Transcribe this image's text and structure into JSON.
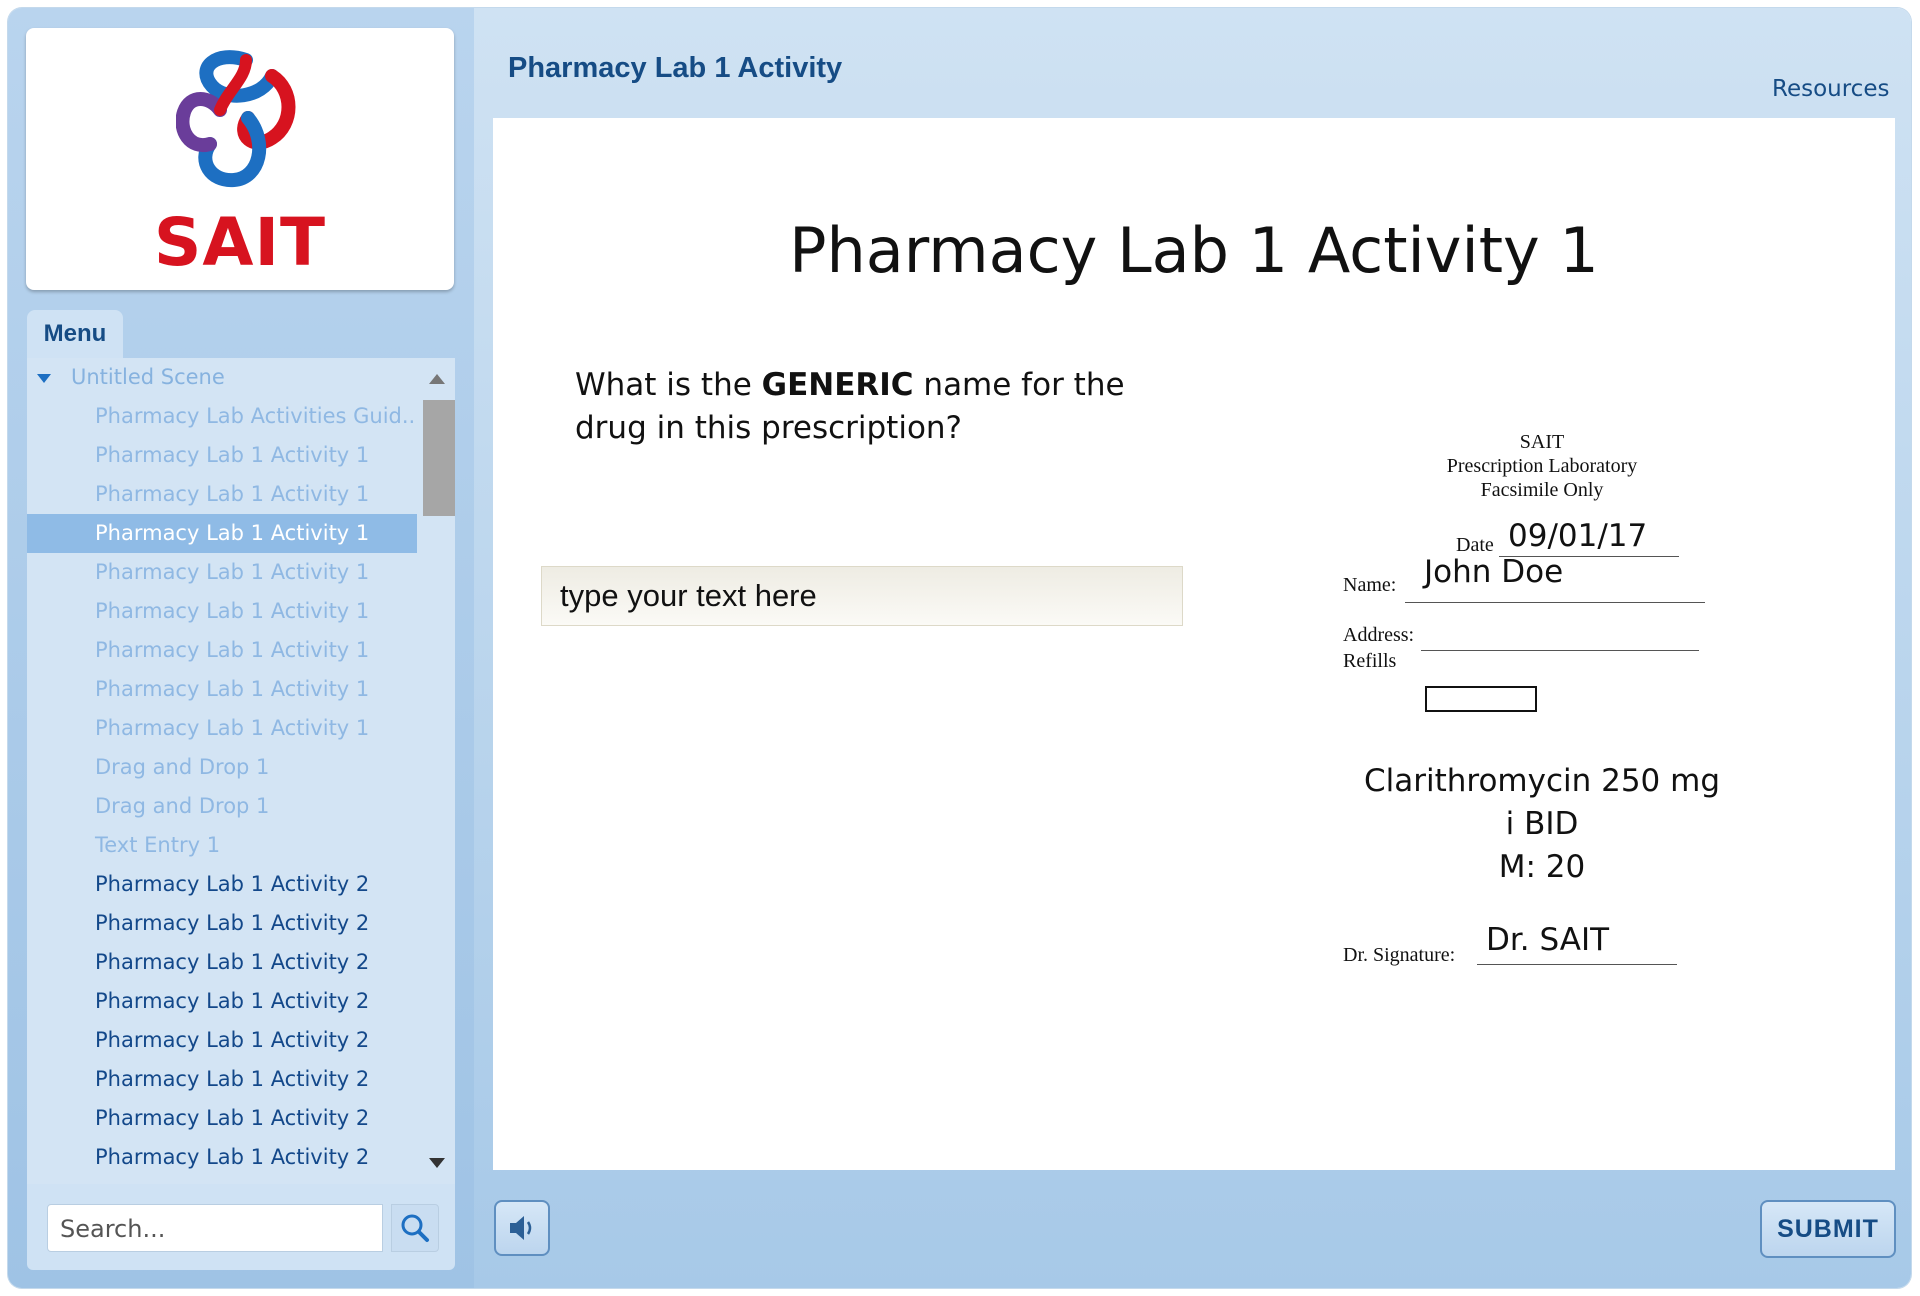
{
  "header": {
    "title": "Pharmacy Lab 1 Activity",
    "resources_label": "Resources"
  },
  "logo": {
    "text": "SAIT",
    "brand_red": "#d7131f",
    "brand_blue": "#1d6fc2",
    "brand_purple": "#6a3d9a"
  },
  "sidebar": {
    "menu_tab": "Menu",
    "scene": {
      "label": "Untitled Scene",
      "icon": "triangle-down-icon"
    },
    "items": [
      {
        "label": "Pharmacy Lab Activities Guid...",
        "state": "visited"
      },
      {
        "label": "Pharmacy Lab 1 Activity 1",
        "state": "visited"
      },
      {
        "label": "Pharmacy Lab 1 Activity 1",
        "state": "visited"
      },
      {
        "label": "Pharmacy Lab 1 Activity 1",
        "state": "selected"
      },
      {
        "label": "Pharmacy Lab 1 Activity 1",
        "state": "visited"
      },
      {
        "label": "Pharmacy Lab 1 Activity 1",
        "state": "visited"
      },
      {
        "label": "Pharmacy Lab 1 Activity 1",
        "state": "visited"
      },
      {
        "label": "Pharmacy Lab 1 Activity 1",
        "state": "visited"
      },
      {
        "label": "Pharmacy Lab 1 Activity 1",
        "state": "visited"
      },
      {
        "label": "Drag and Drop 1",
        "state": "visited"
      },
      {
        "label": "Drag and Drop 1",
        "state": "visited"
      },
      {
        "label": "Text Entry 1",
        "state": "visited"
      },
      {
        "label": "Pharmacy Lab 1 Activity 2",
        "state": "unvisited"
      },
      {
        "label": "Pharmacy Lab 1 Activity 2",
        "state": "unvisited"
      },
      {
        "label": "Pharmacy Lab 1 Activity 2",
        "state": "unvisited"
      },
      {
        "label": "Pharmacy Lab 1 Activity 2",
        "state": "unvisited"
      },
      {
        "label": "Pharmacy Lab 1 Activity 2",
        "state": "unvisited"
      },
      {
        "label": "Pharmacy Lab 1 Activity 2",
        "state": "unvisited"
      },
      {
        "label": "Pharmacy Lab 1 Activity 2",
        "state": "unvisited"
      },
      {
        "label": "Pharmacy Lab 1 Activity 2",
        "state": "unvisited"
      }
    ],
    "search": {
      "placeholder": "Search...",
      "icon": "search-icon"
    }
  },
  "slide": {
    "title": "Pharmacy Lab 1 Activity 1",
    "question_before": "What is the ",
    "question_emphasis": "GENERIC",
    "question_after": " name for the drug in this prescription?",
    "answer_placeholder": "type your text here"
  },
  "prescription": {
    "header_line1": "SAIT",
    "header_line2": "Prescription Laboratory",
    "header_line3": "Facsimile Only",
    "date_label": "Date",
    "date_value": "09/01/17",
    "name_label": "Name:",
    "name_value": "John Doe",
    "address_label": "Address:",
    "address_value": "",
    "refills_label": "Refills",
    "drug_line1": "Clarithromycin 250 mg",
    "drug_line2": "i BID",
    "drug_line3": "M: 20",
    "signature_label": "Dr. Signature:",
    "signature_value": "Dr. SAIT"
  },
  "footer": {
    "audio_icon": "speaker-icon",
    "submit_label": "SUBMIT"
  }
}
